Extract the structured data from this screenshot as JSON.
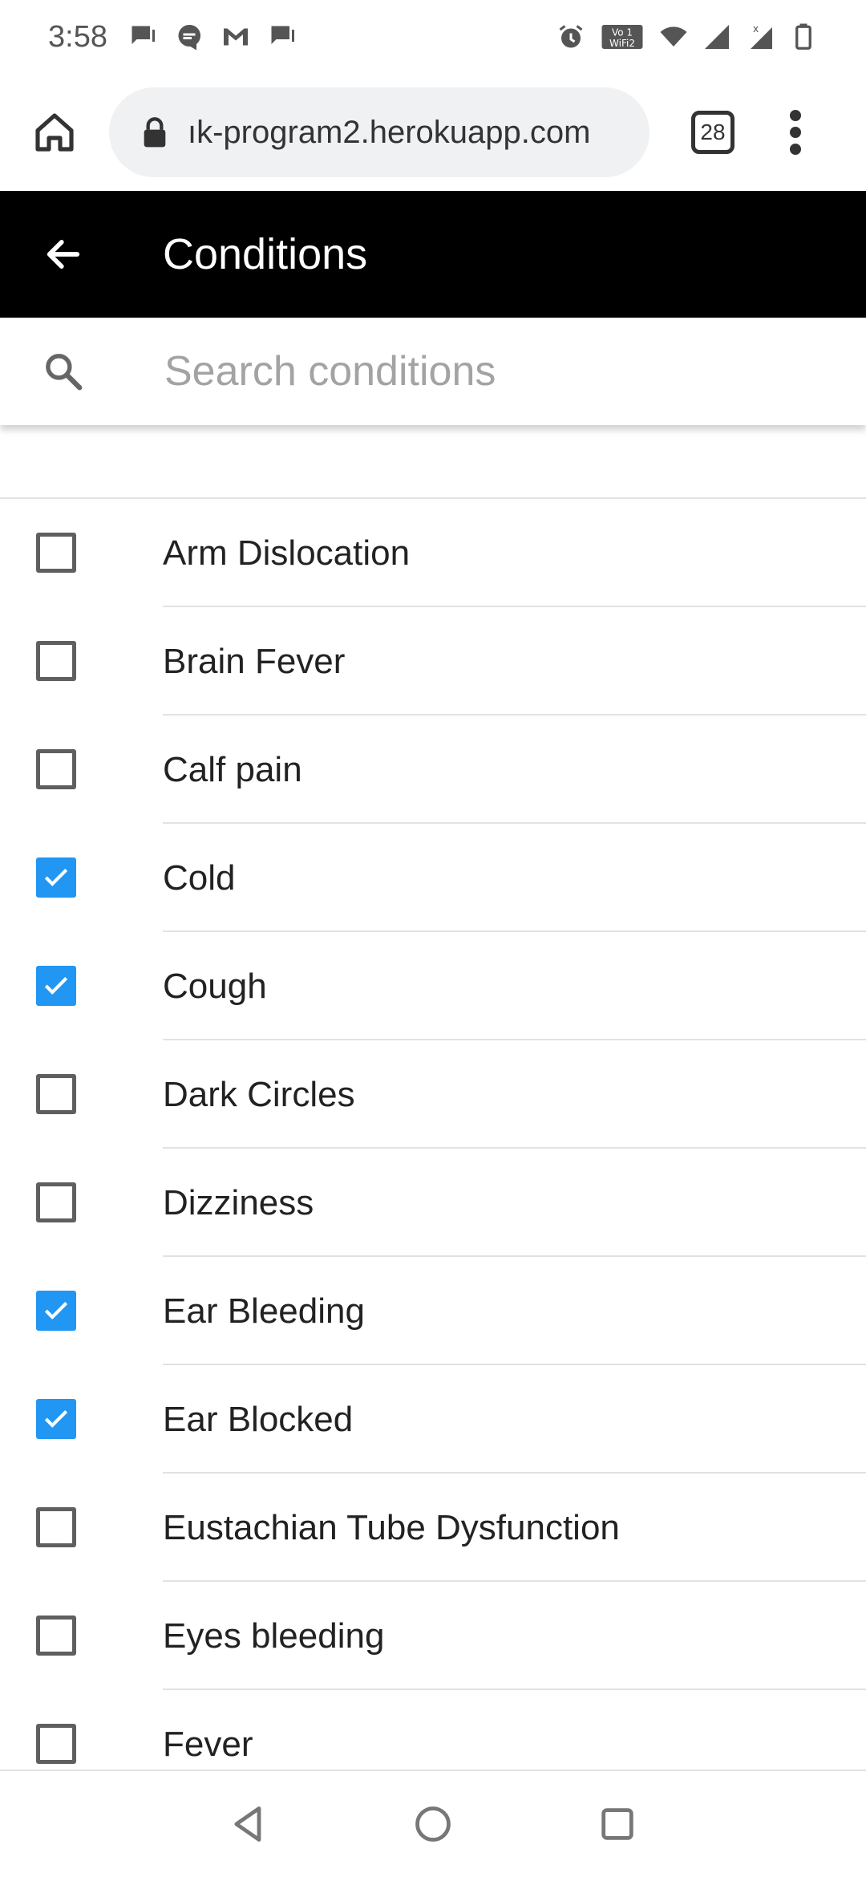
{
  "status_bar": {
    "time": "3:58",
    "left_icons": [
      "chat-icon",
      "message-icon",
      "gmail-icon",
      "chat-icon"
    ],
    "right_icons": [
      "alarm-icon",
      "vowifi-icon",
      "wifi-icon",
      "signal-icon",
      "signal-no-data-icon",
      "battery-icon"
    ]
  },
  "browser": {
    "url": "herokuapp.com",
    "url_display": "ık-program2.herokuapp.com",
    "tab_count": "28"
  },
  "header": {
    "title": "Conditions"
  },
  "search": {
    "placeholder": "Search conditions",
    "value": ""
  },
  "conditions": [
    {
      "label": "Arm Dislocation",
      "checked": false
    },
    {
      "label": "Brain Fever",
      "checked": false
    },
    {
      "label": "Calf pain",
      "checked": false
    },
    {
      "label": "Cold",
      "checked": true
    },
    {
      "label": "Cough",
      "checked": true
    },
    {
      "label": "Dark Circles",
      "checked": false
    },
    {
      "label": "Dizziness",
      "checked": false
    },
    {
      "label": "Ear Bleeding",
      "checked": true
    },
    {
      "label": "Ear Blocked",
      "checked": true
    },
    {
      "label": "Eustachian Tube Dysfunction",
      "checked": false
    },
    {
      "label": "Eyes bleeding",
      "checked": false
    },
    {
      "label": "Fever",
      "checked": false
    }
  ],
  "colors": {
    "header_bg": "#000000",
    "checkbox_checked": "#2196f3",
    "checkbox_unchecked": "#5f5f5f"
  }
}
